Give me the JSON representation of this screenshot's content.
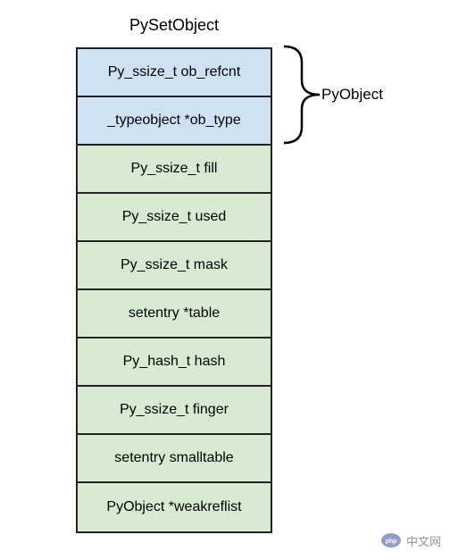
{
  "struct": {
    "title": "PySetObject",
    "fields": [
      {
        "label": "Py_ssize_t ob_refcnt",
        "color": "blue"
      },
      {
        "label": "_typeobject *ob_type",
        "color": "blue"
      },
      {
        "label": "Py_ssize_t fill",
        "color": "green"
      },
      {
        "label": "Py_ssize_t used",
        "color": "green"
      },
      {
        "label": "Py_ssize_t mask",
        "color": "green"
      },
      {
        "label": "setentry *table",
        "color": "green"
      },
      {
        "label": "Py_hash_t hash",
        "color": "green"
      },
      {
        "label": "Py_ssize_t finger",
        "color": "green"
      },
      {
        "label": "setentry smalltable",
        "color": "green"
      },
      {
        "label": "PyObject *weakreflist",
        "color": "green"
      }
    ]
  },
  "brace_label": "PyObject",
  "watermark": {
    "text": "中文网"
  }
}
